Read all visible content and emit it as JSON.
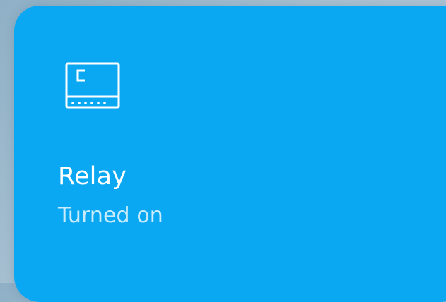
{
  "tile": {
    "name": "Relay",
    "status": "Turned on",
    "icon": "relay-icon",
    "background_color": "#0aa8f3"
  }
}
